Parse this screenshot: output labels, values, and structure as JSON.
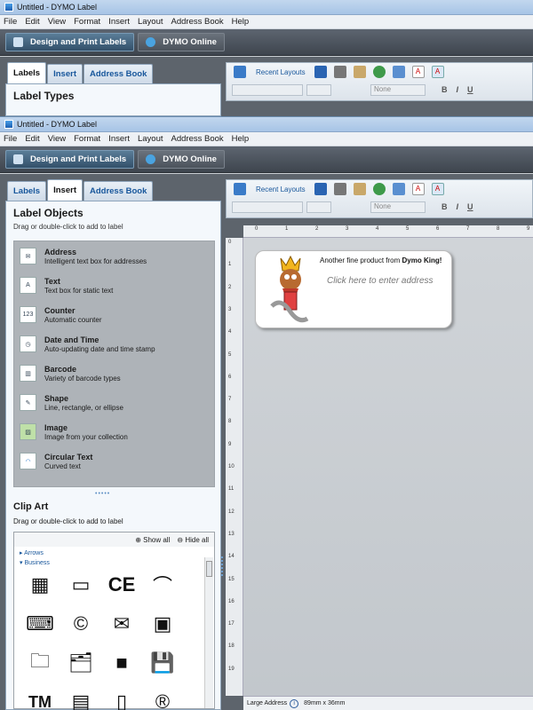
{
  "window1": {
    "title": "Untitled - DYMO Label",
    "active_tab": "Labels",
    "panel_title": "Label Types"
  },
  "window2": {
    "title": "Untitled - DYMO Label",
    "active_tab": "Insert"
  },
  "menu": [
    "File",
    "Edit",
    "View",
    "Format",
    "Insert",
    "Layout",
    "Address Book",
    "Help"
  ],
  "topbar": {
    "design": "Design and Print Labels",
    "online": "DYMO Online"
  },
  "tabs": [
    "Labels",
    "Insert",
    "Address Book"
  ],
  "toolbar": {
    "recent": "Recent Layouts",
    "font_dd": "None",
    "bold": "B",
    "italic": "I",
    "underline": "U",
    "letter": "A"
  },
  "objects": {
    "title": "Label Objects",
    "hint": "Drag or double-click to add to label",
    "items": [
      {
        "name": "Address",
        "desc": "Intelligent text box for addresses"
      },
      {
        "name": "Text",
        "desc": "Text box for static text"
      },
      {
        "name": "Counter",
        "desc": "Automatic counter"
      },
      {
        "name": "Date and Time",
        "desc": "Auto-updating date and time stamp"
      },
      {
        "name": "Barcode",
        "desc": "Variety of barcode types"
      },
      {
        "name": "Shape",
        "desc": "Line, rectangle, or ellipse"
      },
      {
        "name": "Image",
        "desc": "Image from your collection"
      },
      {
        "name": "Circular Text",
        "desc": "Curved text"
      }
    ]
  },
  "clipart": {
    "title": "Clip Art",
    "hint": "Drag or double-click to add to label",
    "show_all": "Show all",
    "hide_all": "Hide all",
    "cat1": "Arrows",
    "cat2": "Business",
    "glyphs": [
      "▦",
      "▭",
      "CE",
      "⌒",
      "⌨",
      "©",
      "✉",
      "▣",
      "🗀",
      "🗂",
      "■",
      "💾",
      "TM",
      "▤",
      "▯",
      "®"
    ]
  },
  "label": {
    "line1": "Another fine product from ",
    "line1_bold": "Dymo King!",
    "line2": "Click here to enter address"
  },
  "ruler_h": [
    "0",
    "1",
    "2",
    "3",
    "4",
    "5",
    "6",
    "7",
    "8",
    "9"
  ],
  "ruler_v": [
    "0",
    "1",
    "2",
    "3",
    "4",
    "5",
    "6",
    "7",
    "8",
    "9",
    "10",
    "11",
    "12",
    "13",
    "14",
    "15",
    "16",
    "17",
    "18",
    "19"
  ],
  "status": {
    "label_type": "Large Address",
    "size": "89mm x 36mm"
  },
  "colors": {
    "accent": "#17569b",
    "topbar": "#4a515a"
  }
}
